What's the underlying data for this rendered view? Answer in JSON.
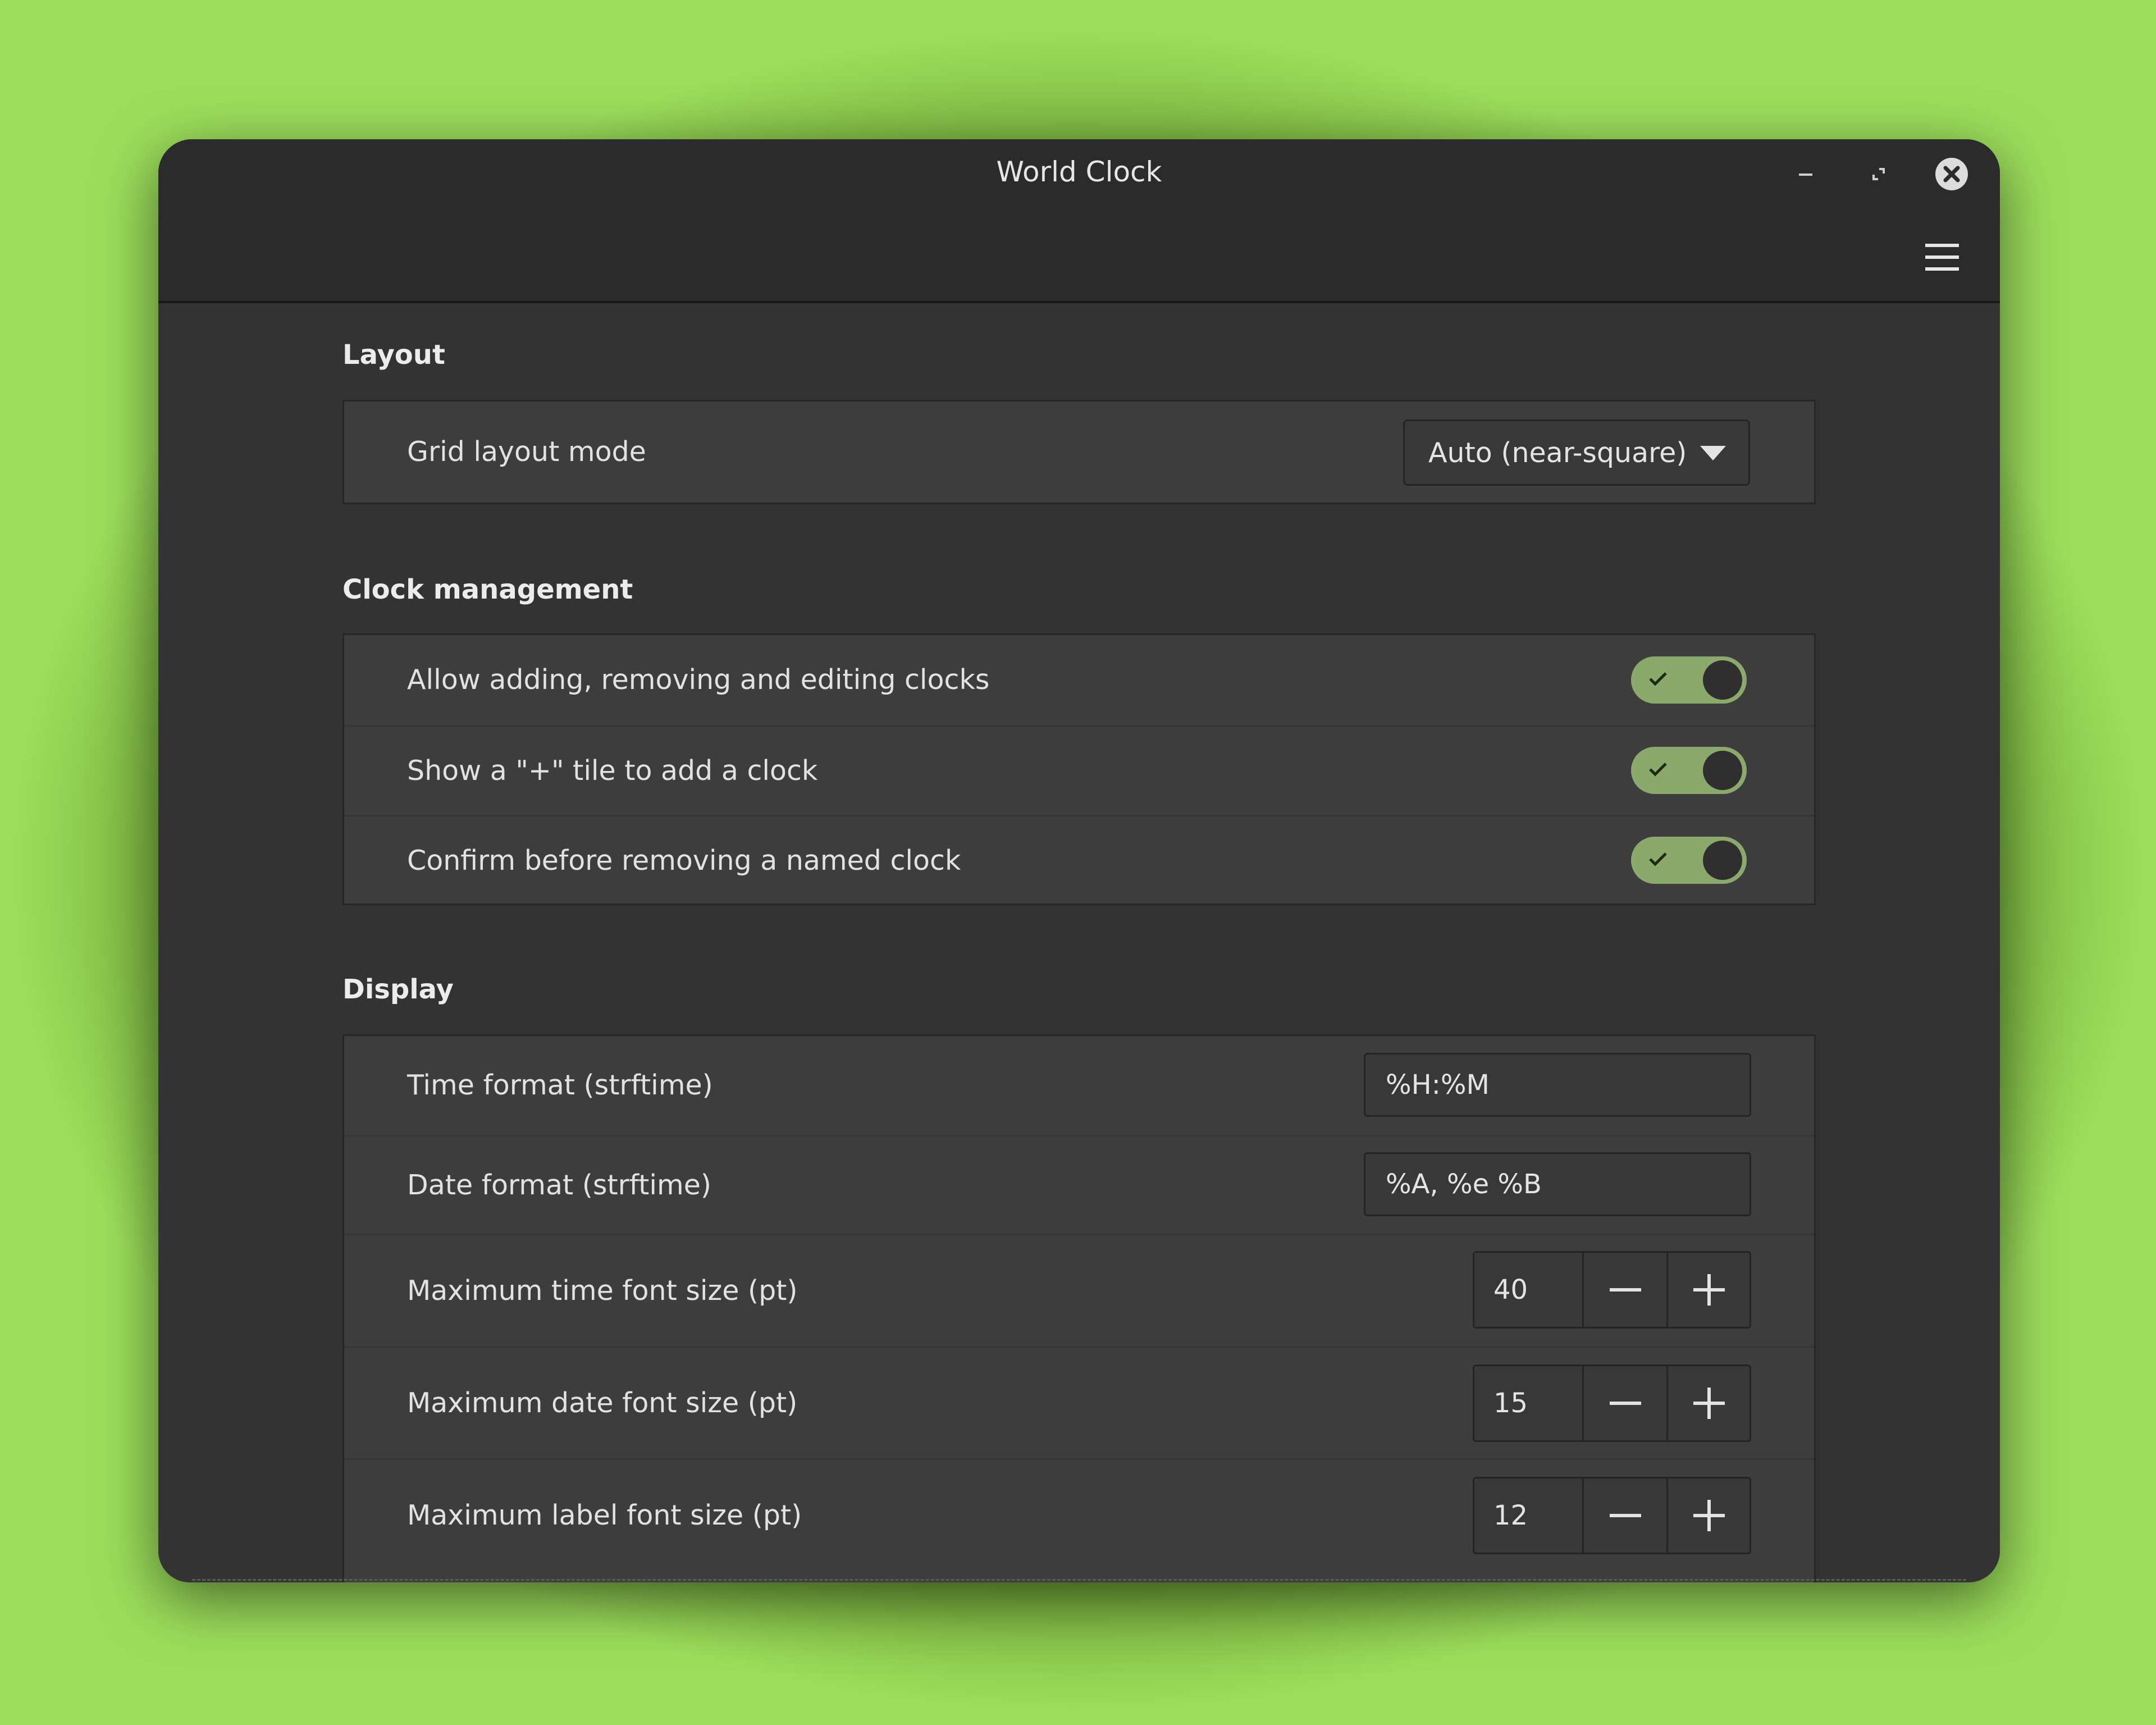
{
  "window": {
    "title": "World Clock"
  },
  "icons": {
    "minimize": "minimize-icon",
    "maximize": "maximize-icon",
    "close": "close-icon",
    "menu": "hamburger-menu-icon",
    "dropdown": "triangle-down-icon",
    "check": "check-icon",
    "minus": "minus-icon",
    "plus": "plus-icon"
  },
  "colors": {
    "toggle_on": "#8ba96a",
    "window_bg": "#333333",
    "header_bg": "#2b2b2b",
    "row_bg": "#3d3d3d"
  },
  "layout_section": {
    "title": "Layout",
    "grid_layout_mode": {
      "label": "Grid layout mode",
      "value": "Auto (near-square)"
    }
  },
  "clock_management": {
    "title": "Clock management",
    "rows": [
      {
        "label": "Allow adding, removing and editing clocks",
        "enabled": true
      },
      {
        "label": "Show a \"+\" tile to add a clock",
        "enabled": true
      },
      {
        "label": "Confirm before removing a named clock",
        "enabled": true
      }
    ]
  },
  "display": {
    "title": "Display",
    "time_format": {
      "label": "Time format (strftime)",
      "value": "%H:%M"
    },
    "date_format": {
      "label": "Date format (strftime)",
      "value": "%A, %e %B"
    },
    "spin_rows": [
      {
        "label": "Maximum time font size (pt)",
        "value": "40"
      },
      {
        "label": "Maximum date font size (pt)",
        "value": "15"
      },
      {
        "label": "Maximum label font size (pt)",
        "value": "12"
      }
    ]
  }
}
